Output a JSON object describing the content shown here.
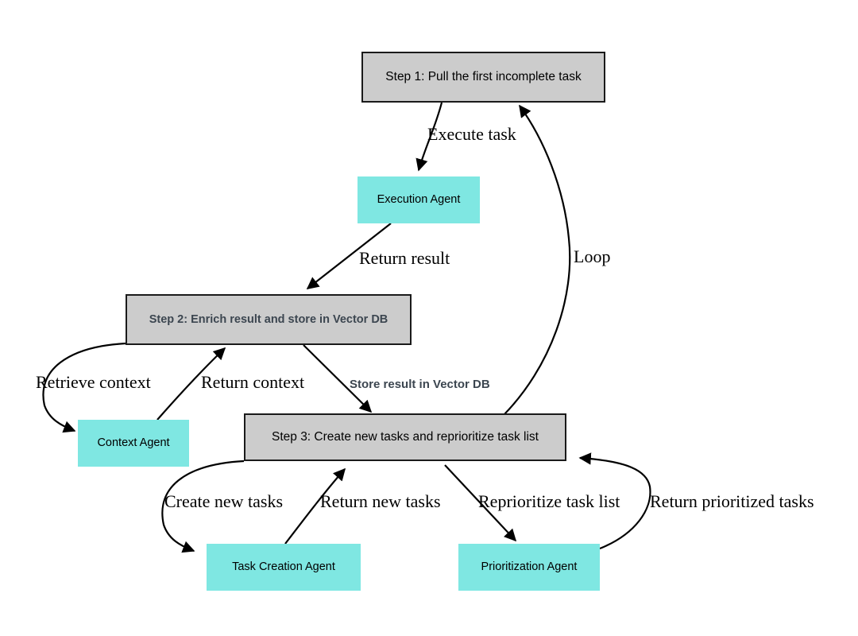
{
  "diagram": {
    "title": "BabyAGI task loop flowchart",
    "background_color": "#ffffff",
    "colors": {
      "step_fill": "#cccccc",
      "step_stroke": "#1a1a1a",
      "agent_fill": "#7fe7e2",
      "edge_stroke": "#000000",
      "step_text": "#000000",
      "alt_text": "#3c4650"
    },
    "nodes": [
      {
        "id": "step1",
        "label": "Step 1: Pull the first incomplete task",
        "kind": "step"
      },
      {
        "id": "execution_agent",
        "label": "Execution Agent",
        "kind": "agent"
      },
      {
        "id": "step2",
        "label": "Step 2: Enrich result and store in Vector DB",
        "kind": "step-alt"
      },
      {
        "id": "context_agent",
        "label": "Context Agent",
        "kind": "agent"
      },
      {
        "id": "step3",
        "label": "Step 3: Create new tasks and reprioritize task list",
        "kind": "step"
      },
      {
        "id": "task_creation_agent",
        "label": "Task Creation Agent",
        "kind": "agent"
      },
      {
        "id": "prioritization_agent",
        "label": "Prioritization Agent",
        "kind": "agent"
      }
    ],
    "edges": [
      {
        "id": "e1",
        "from": "step1",
        "to": "execution_agent",
        "label": "Execute task"
      },
      {
        "id": "e2",
        "from": "execution_agent",
        "to": "step2",
        "label": "Return result"
      },
      {
        "id": "e3",
        "from": "step2",
        "to": "context_agent",
        "label": "Retrieve context"
      },
      {
        "id": "e4",
        "from": "context_agent",
        "to": "step2",
        "label": "Return context"
      },
      {
        "id": "e5",
        "from": "step2",
        "to": "step3",
        "label": "Store result in Vector DB"
      },
      {
        "id": "e6",
        "from": "step3",
        "to": "task_creation_agent",
        "label": "Create new tasks"
      },
      {
        "id": "e7",
        "from": "task_creation_agent",
        "to": "step3",
        "label": "Return new tasks"
      },
      {
        "id": "e8",
        "from": "step3",
        "to": "prioritization_agent",
        "label": "Reprioritize task list"
      },
      {
        "id": "e9",
        "from": "prioritization_agent",
        "to": "step3",
        "label": "Return prioritized tasks"
      },
      {
        "id": "e10",
        "from": "step3",
        "to": "step1",
        "label": "Loop"
      }
    ]
  }
}
